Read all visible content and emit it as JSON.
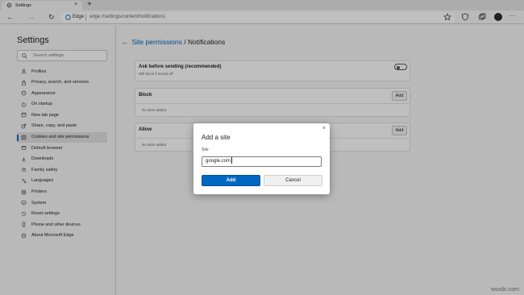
{
  "browser": {
    "tab_title": "Settings",
    "tab_close": "×",
    "new_tab": "+",
    "nav_back": "←",
    "nav_forward": "→",
    "nav_refresh": "↻",
    "address_brand": "Edge",
    "address_url": "edge://settings/content/notifications",
    "more_menu": "···"
  },
  "sidebar": {
    "title": "Settings",
    "search_placeholder": "Search settings",
    "items": [
      {
        "label": "Profiles",
        "icon": "profile-icon"
      },
      {
        "label": "Privacy, search, and services",
        "icon": "lock-icon"
      },
      {
        "label": "Appearance",
        "icon": "appearance-icon"
      },
      {
        "label": "On startup",
        "icon": "power-icon"
      },
      {
        "label": "New tab page",
        "icon": "new-tab-icon"
      },
      {
        "label": "Share, copy, and paste",
        "icon": "share-icon"
      },
      {
        "label": "Cookies and site permissions",
        "icon": "cookie-icon",
        "selected": true
      },
      {
        "label": "Default browser",
        "icon": "browser-icon"
      },
      {
        "label": "Downloads",
        "icon": "download-icon"
      },
      {
        "label": "Family safety",
        "icon": "family-icon"
      },
      {
        "label": "Languages",
        "icon": "languages-icon"
      },
      {
        "label": "Printers",
        "icon": "printer-icon"
      },
      {
        "label": "System",
        "icon": "system-icon"
      },
      {
        "label": "Reset settings",
        "icon": "reset-icon"
      },
      {
        "label": "Phone and other devices",
        "icon": "phone-icon"
      },
      {
        "label": "About Microsoft Edge",
        "icon": "edge-icon"
      }
    ]
  },
  "main": {
    "back_arrow": "←",
    "breadcrumb_link": "Site permissions",
    "breadcrumb_sep": " / ",
    "breadcrumb_current": "Notifications",
    "ask_title": "Ask before sending (recommended)",
    "ask_sub": "Will block if turned off",
    "block_title": "Block",
    "block_add": "Add",
    "block_empty": "No sites added",
    "allow_title": "Allow",
    "allow_add": "Add",
    "allow_empty": "No sites added"
  },
  "dialog": {
    "title": "Add a site",
    "close": "×",
    "field_label": "Site",
    "field_value": "google.com",
    "primary_label": "Add",
    "secondary_label": "Cancel"
  },
  "watermark": "wsxdn.com",
  "colors": {
    "accent": "#0067c0",
    "overlay": "rgba(0,0,0,0.25)"
  }
}
